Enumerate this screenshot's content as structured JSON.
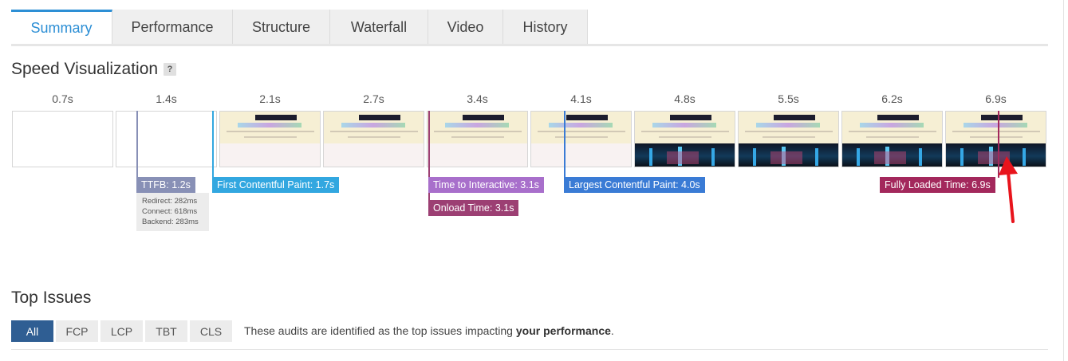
{
  "tabs": [
    {
      "label": "Summary",
      "active": true
    },
    {
      "label": "Performance"
    },
    {
      "label": "Structure"
    },
    {
      "label": "Waterfall"
    },
    {
      "label": "Video"
    },
    {
      "label": "History"
    }
  ],
  "speed": {
    "title": "Speed Visualization",
    "help": "?",
    "frames": [
      {
        "time": "0.7s"
      },
      {
        "time": "1.4s"
      },
      {
        "time": "2.1s"
      },
      {
        "time": "2.7s"
      },
      {
        "time": "3.4s"
      },
      {
        "time": "4.1s"
      },
      {
        "time": "4.8s"
      },
      {
        "time": "5.5s"
      },
      {
        "time": "6.2s"
      },
      {
        "time": "6.9s"
      }
    ],
    "metrics": {
      "ttfb": "TTFB: 1.2s",
      "fcp": "First Contentful Paint: 1.7s",
      "tti": "Time to Interactive: 3.1s",
      "onload": "Onload Time: 3.1s",
      "lcp": "Largest Contentful Paint: 4.0s",
      "fully_loaded": "Fully Loaded Time: 6.9s"
    },
    "ttfb_detail": {
      "redirect": "Redirect: 282ms",
      "connect": "Connect: 618ms",
      "backend": "Backend: 283ms"
    },
    "colors": {
      "ttfb": "#8890b6",
      "fcp": "#32a7e0",
      "tti": "#a86fcb",
      "onload": "#9c3f73",
      "lcp": "#3a7bd5",
      "fully_loaded": "#a3285c",
      "arrow": "#e8141c"
    }
  },
  "issues": {
    "title": "Top Issues",
    "filters": [
      {
        "label": "All",
        "active": true
      },
      {
        "label": "FCP"
      },
      {
        "label": "LCP"
      },
      {
        "label": "TBT"
      },
      {
        "label": "CLS"
      }
    ],
    "description_prefix": "These audits are identified as the top issues impacting ",
    "description_bold": "your performance",
    "description_suffix": "."
  }
}
